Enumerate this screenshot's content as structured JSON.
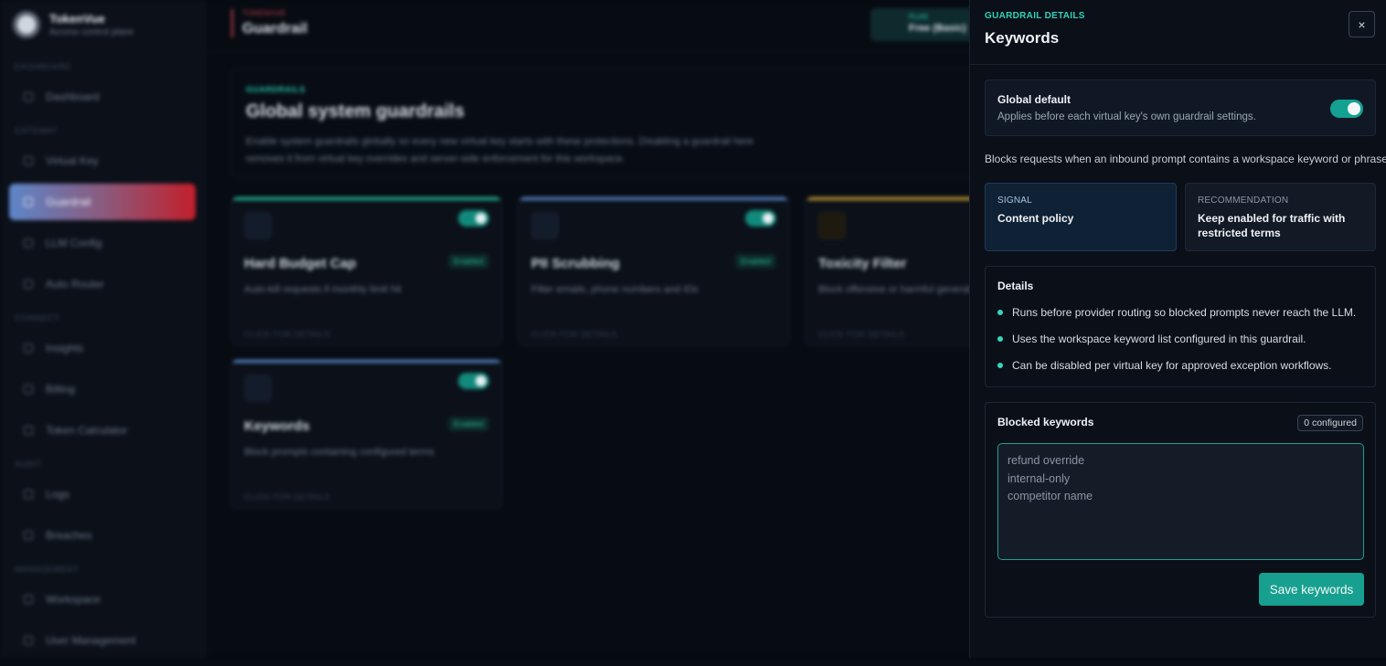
{
  "app": {
    "brand": {
      "name": "TokenVue",
      "subtitle": "Access control plane"
    },
    "sidebar": {
      "sections": [
        {
          "label": "Dashboard",
          "items": [
            {
              "label": "Dashboard",
              "icon": "grid-icon"
            }
          ]
        },
        {
          "label": "Gateway",
          "items": [
            {
              "label": "Virtual Key",
              "icon": "key-icon"
            },
            {
              "label": "Guardrail",
              "icon": "shield-icon",
              "active": true
            },
            {
              "label": "LLM Config",
              "icon": "sliders-icon"
            },
            {
              "label": "Auto Router",
              "icon": "router-icon"
            }
          ]
        },
        {
          "label": "Connect",
          "items": [
            {
              "label": "Insights",
              "icon": "chart-icon"
            },
            {
              "label": "Billing",
              "icon": "card-icon"
            },
            {
              "label": "Token Calculator",
              "icon": "calculator-icon"
            }
          ]
        },
        {
          "label": "Audit",
          "items": [
            {
              "label": "Logs",
              "icon": "doc-icon"
            },
            {
              "label": "Breaches",
              "icon": "alert-icon"
            }
          ]
        },
        {
          "label": "Management",
          "items": [
            {
              "label": "Workspace",
              "icon": "home-icon"
            },
            {
              "label": "User Management",
              "icon": "users-icon"
            }
          ]
        }
      ]
    },
    "topbar": {
      "breadcrumb_small": "TOKENVUE",
      "title": "Guardrail",
      "plan_label": "PLAN",
      "plan_value": "Free (Basic)"
    },
    "hero": {
      "eyebrow": "GUARDRAILS",
      "title": "Global system guardrails",
      "description": "Enable system guardrails globally so every new virtual key starts with these protections. Disabling a guardrail here removes it from virtual key overrides and server-side enforcement for this workspace."
    },
    "cards": [
      {
        "title": "Hard Budget Cap",
        "badge": "Enabled",
        "description": "Auto-kill requests if monthly limit hit",
        "link": "CLICK FOR DETAILS",
        "color": "#21c49f",
        "enabled": true
      },
      {
        "title": "PII Scrubbing",
        "badge": "Enabled",
        "description": "Filter emails, phone numbers and IDs",
        "link": "CLICK FOR DETAILS",
        "color": "#5b8fd9",
        "enabled": true
      },
      {
        "title": "Toxicity Filter",
        "badge": "",
        "description": "Block offensive or harmful generations",
        "link": "CLICK FOR DETAILS",
        "color": "#d4a52a",
        "enabled": false
      },
      {
        "title": "Keywords",
        "badge": "Enabled",
        "description": "Block prompts containing configured terms",
        "link": "CLICK FOR DETAILS",
        "color": "#5b8fd9",
        "enabled": true
      }
    ]
  },
  "panel": {
    "eyebrow": "GUARDRAIL DETAILS",
    "title": "Keywords",
    "close_label": "×",
    "global_default": {
      "title": "Global default",
      "subtitle": "Applies before each virtual key's own guardrail settings.",
      "enabled": true
    },
    "description": "Blocks requests when an inbound prompt contains a workspace keyword or phrase.",
    "signal": {
      "label": "SIGNAL",
      "value": "Content policy"
    },
    "recommendation": {
      "label": "RECOMMENDATION",
      "value": "Keep enabled for traffic with restricted terms"
    },
    "details": {
      "title": "Details",
      "items": [
        "Runs before provider routing so blocked prompts never reach the LLM.",
        "Uses the workspace keyword list configured in this guardrail.",
        "Can be disabled per virtual key for approved exception workflows."
      ]
    },
    "keywords": {
      "title": "Blocked keywords",
      "count": "0 configured",
      "value": "",
      "placeholder": "refund override\ninternal-only\ncompetitor name",
      "save_label": "Save keywords"
    }
  },
  "colors": {
    "accent": "#17a08f",
    "accent_text": "#2fd3b5",
    "panel_bg": "#0a0f18",
    "page_bg": "#070b12"
  }
}
